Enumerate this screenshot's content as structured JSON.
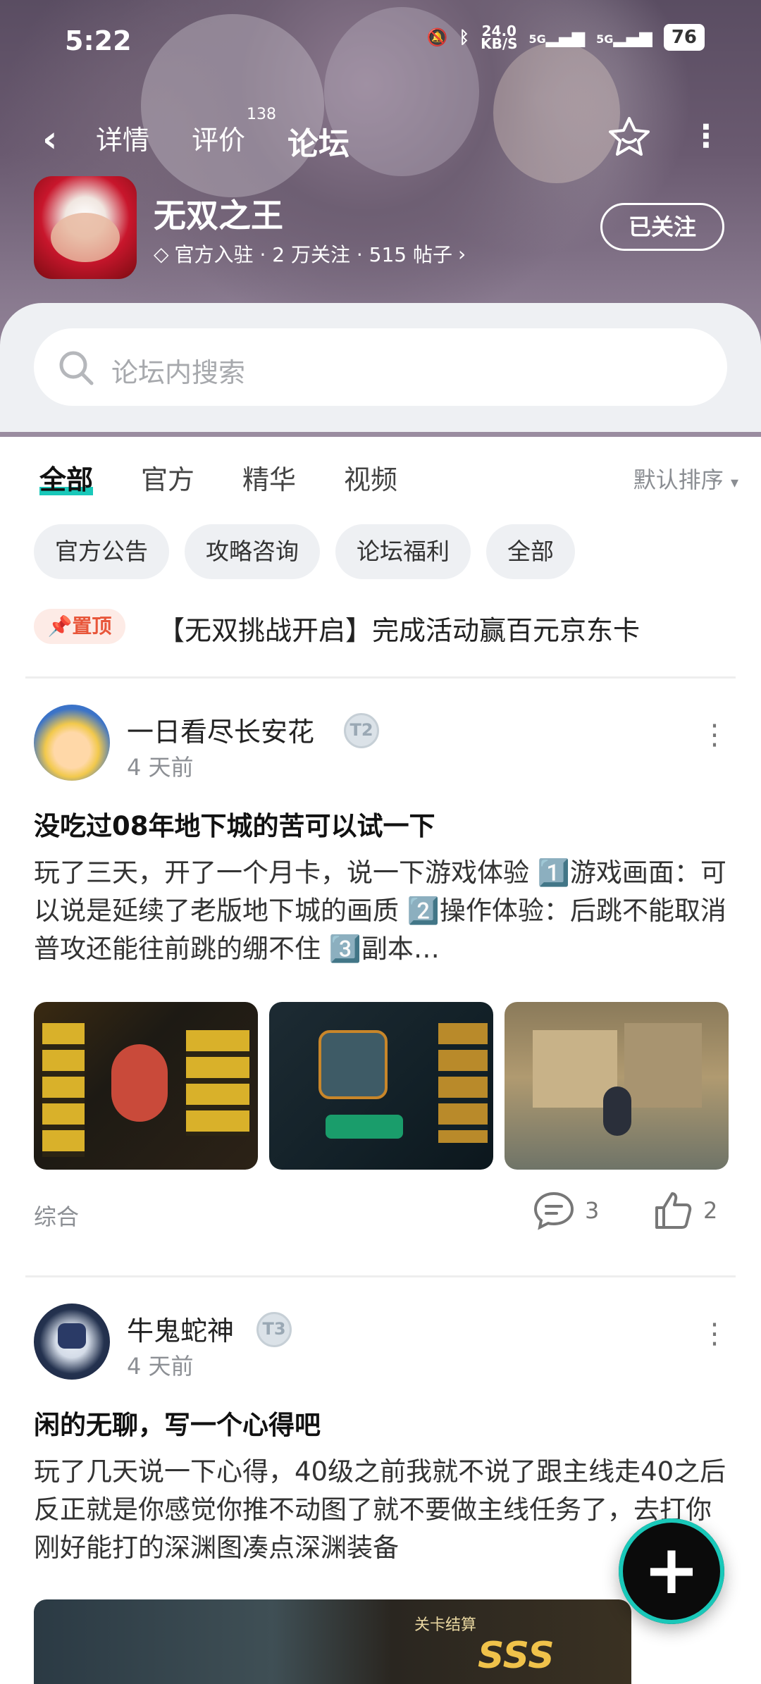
{
  "status_bar": {
    "time": "5:22",
    "net_speed": "24.0\nKB/S",
    "net1": "5G",
    "net2": "5G",
    "battery": "76"
  },
  "nav": {
    "tabs": [
      {
        "label": "详情"
      },
      {
        "label": "评价",
        "badge": "138"
      },
      {
        "label": "论坛"
      }
    ],
    "active_tab": "论坛"
  },
  "game": {
    "name": "无双之王",
    "meta": "官方入驻 · 2 万关注 · 515 帖子",
    "follow_label": "已关注"
  },
  "search": {
    "placeholder": "论坛内搜索"
  },
  "filter_tabs": [
    "全部",
    "官方",
    "精华",
    "视频"
  ],
  "sort_label": "默认排序",
  "chips": [
    "官方公告",
    "攻略咨询",
    "论坛福利",
    "全部"
  ],
  "pinned": {
    "tag": "置顶",
    "text": "【无双挑战开启】完成活动赢百元京东卡"
  },
  "posts": [
    {
      "user": "一日看尽长安花",
      "level": "T2",
      "time": "4 天前",
      "title": "没吃过08年地下城的苦可以试一下",
      "body": "玩了三天，开了一个月卡，说一下游戏体验 1️⃣游戏画面：可以说是延续了老版地下城的画质 2️⃣操作体验：后跳不能取消普攻还能往前跳的绷不住 3️⃣副本…",
      "category": "综合",
      "comments": "3",
      "likes": "2"
    },
    {
      "user": "牛鬼蛇神",
      "level": "T3",
      "time": "4 天前",
      "title": "闲的无聊，写一个心得吧",
      "body": "玩了几天说一下心得，40级之前我就不说了跟主线走40之后反正就是你感觉你推不动图了就不要做主线任务了，去打你刚好能打的深渊图凑点深渊装备",
      "image_label": "关卡结算",
      "image_rank": "SSS"
    }
  ],
  "colors": {
    "accent": "#19c8b9",
    "pin": "#e8563a"
  }
}
